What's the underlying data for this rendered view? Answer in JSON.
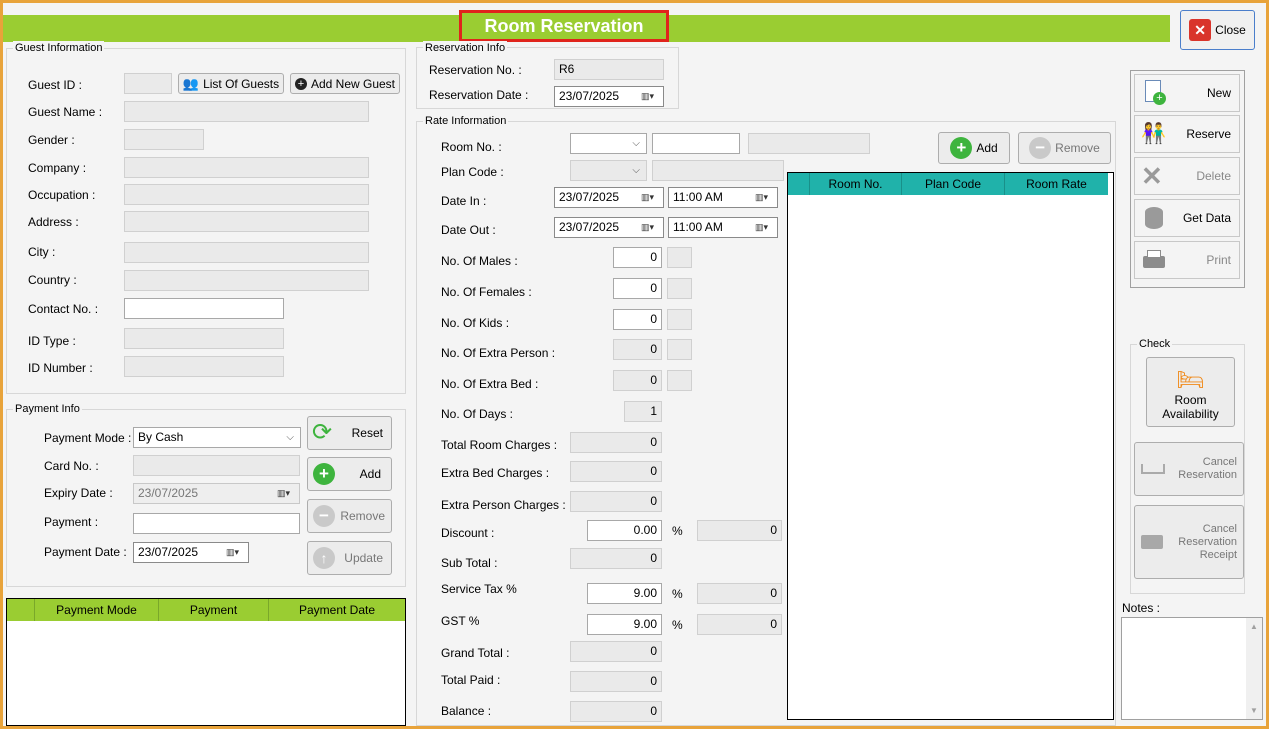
{
  "window": {
    "title": "Room Reservation",
    "close_label": "Close"
  },
  "guest": {
    "group_title": "Guest Information",
    "guest_id_label": "Guest ID :",
    "guest_id_value": "",
    "list_btn": "List Of Guests",
    "add_btn": "Add New Guest",
    "name_label": "Guest Name :",
    "gender_label": "Gender :",
    "company_label": "Company :",
    "occupation_label": "Occupation :",
    "address_label": "Address :",
    "city_label": "City :",
    "country_label": "Country :",
    "contact_label": "Contact No. :",
    "idtype_label": "ID Type :",
    "idnumber_label": "ID Number :"
  },
  "payment": {
    "group_title": "Payment Info",
    "mode_label": "Payment Mode :",
    "mode_value": "By Cash",
    "card_label": "Card No. :",
    "expiry_label": "Expiry Date :",
    "expiry_value": "23/07/2025",
    "payment_label": "Payment :",
    "date_label": "Payment Date :",
    "date_value": "23/07/2025",
    "reset_btn": "Reset",
    "add_btn": "Add",
    "remove_btn": "Remove",
    "update_btn": "Update",
    "columns": [
      "Payment Mode",
      "Payment",
      "Payment Date"
    ]
  },
  "reservation": {
    "group_title": "Reservation Info",
    "no_label": "Reservation No. :",
    "no_value": "R6",
    "date_label": "Reservation Date :",
    "date_value": "23/07/2025"
  },
  "rate": {
    "group_title": "Rate Information",
    "room_label": "Room No. :",
    "plan_label": "Plan Code :",
    "datein_label": "Date In :",
    "datein_value": "23/07/2025",
    "timein_value": "11:00 AM",
    "dateout_label": "Date Out :",
    "dateout_value": "23/07/2025",
    "timeout_value": "11:00 AM",
    "males_label": "No. Of Males :",
    "males_value": "0",
    "females_label": "No. Of Females :",
    "females_value": "0",
    "kids_label": "No. Of Kids :",
    "kids_value": "0",
    "extra_person_label": "No. Of Extra Person :",
    "extra_person_value": "0",
    "extra_bed_label": "No. Of Extra Bed :",
    "extra_bed_value": "0",
    "days_label": "No. Of Days :",
    "days_value": "1",
    "total_room_label": "Total Room Charges :",
    "total_room_value": "0",
    "extra_bed_charges_label": "Extra Bed Charges :",
    "extra_bed_charges_value": "0",
    "extra_person_charges_label": "Extra Person Charges :",
    "extra_person_charges_value": "0",
    "discount_label": "Discount :",
    "discount_value": "0.00",
    "discount_pct": "%",
    "discount_amount": "0",
    "subtotal_label": "Sub Total :",
    "subtotal_value": "0",
    "service_tax_label": "Service Tax %",
    "service_tax_value": "9.00",
    "service_tax_pct": "%",
    "service_tax_amount": "0",
    "gst_label": "GST %",
    "gst_value": "9.00",
    "gst_pct": "%",
    "gst_amount": "0",
    "grand_total_label": "Grand Total :",
    "grand_total_value": "0",
    "total_paid_label": "Total Paid :",
    "total_paid_value": "0",
    "balance_label": "Balance :",
    "balance_value": "0",
    "add_btn": "Add",
    "remove_btn": "Remove",
    "columns": [
      "Room No.",
      "Plan Code",
      "Room Rate"
    ]
  },
  "toolbar": {
    "new": "New",
    "reserve": "Reserve",
    "delete": "Delete",
    "get_data": "Get Data",
    "print": "Print"
  },
  "check": {
    "group_title": "Check",
    "room_avail": "Room Availability",
    "cancel_res": "Cancel Reservation",
    "cancel_receipt": "Cancel Reservation Receipt"
  },
  "notes": {
    "label": "Notes :"
  }
}
